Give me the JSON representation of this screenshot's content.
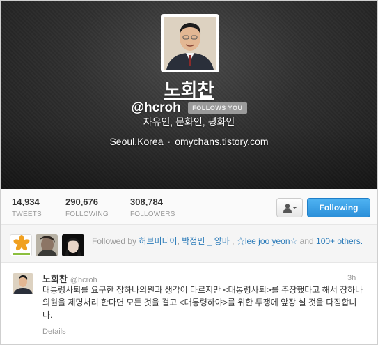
{
  "profile": {
    "name": "노회찬",
    "handle": "@hcroh",
    "follows_you": "FOLLOWS YOU",
    "bio": "자유인, 문화인, 평화인",
    "location": "Seoul,Korea",
    "separator": "·",
    "url": "omychans.tistory.com"
  },
  "stats": [
    {
      "value": "14,934",
      "label": "TWEETS"
    },
    {
      "value": "290,676",
      "label": "FOLLOWING"
    },
    {
      "value": "308,784",
      "label": "FOLLOWERS"
    }
  ],
  "actions": {
    "follow_label": "Following"
  },
  "followed_by": {
    "prefix": "Followed by",
    "users": [
      "허브미디어",
      "박정민 _ 양마",
      "☆lee joo yeon☆"
    ],
    "sep1": ", ",
    "sep2": " , ",
    "and": "and",
    "others": "100+ others."
  },
  "tweet": {
    "name": "노회찬",
    "handle": "@hcroh",
    "time": "3h",
    "text": "대통령사퇴를 요구한 장하나의원과 생각이 다르지만 <대통령사퇴>를 주장했다고 해서 장하나의원을 제명처리 한다면 모든 것을 걸고 <대통령하야>를 위한 투쟁에 앞장 설 것을 다짐합니다.",
    "details": "Details"
  },
  "colors": {
    "accent": "#2b7bb9",
    "follow_button": "#2b8fd9"
  },
  "icons": {
    "user_menu": "person-with-caret-icon"
  }
}
